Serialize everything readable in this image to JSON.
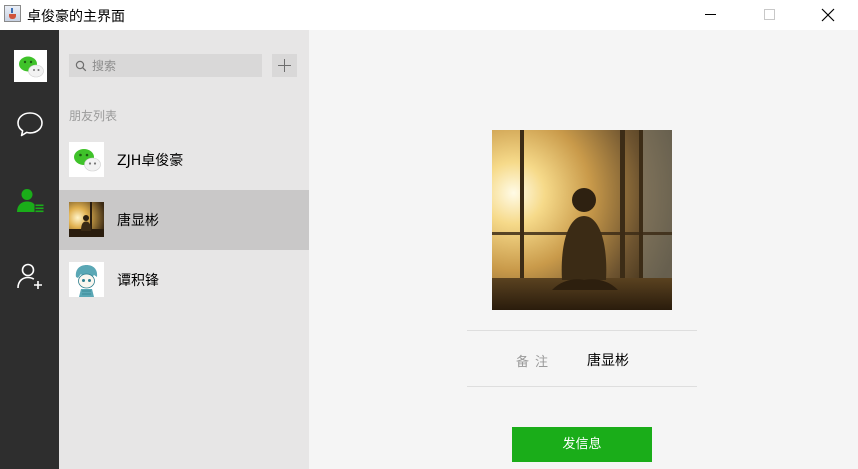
{
  "window": {
    "title": "卓俊豪的主界面",
    "controls": {
      "minimize": "minimize-icon",
      "maximize": "maximize-icon",
      "close": "close-icon"
    }
  },
  "nav": {
    "items": [
      {
        "name": "chat",
        "icon": "chat-bubble-icon",
        "active": false
      },
      {
        "name": "contacts",
        "icon": "contacts-icon",
        "active": true
      },
      {
        "name": "add-friend",
        "icon": "add-friend-icon",
        "active": false
      }
    ],
    "active_color": "#1aad19"
  },
  "search": {
    "placeholder": "搜索"
  },
  "contacts": {
    "section_label": "朋友列表",
    "items": [
      {
        "name": "ZJH卓俊豪",
        "avatar": "wechat-logo-avatar",
        "selected": false
      },
      {
        "name": "唐显彬",
        "avatar": "sunset-window-photo",
        "selected": true
      },
      {
        "name": "谭积锋",
        "avatar": "anime-character-avatar",
        "selected": false
      }
    ]
  },
  "profile": {
    "remark_label": "备注",
    "remark_value": "唐显彬",
    "send_button": "发信息",
    "button_color": "#1aad19"
  }
}
